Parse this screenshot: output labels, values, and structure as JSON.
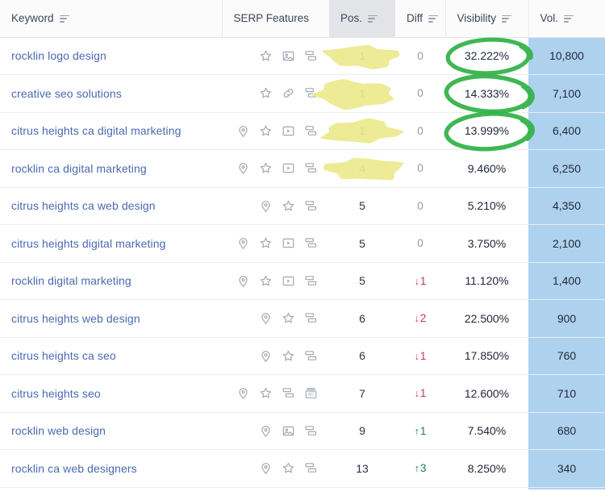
{
  "table": {
    "columns": [
      {
        "key": "keyword",
        "label": "Keyword",
        "sortable": true,
        "sorted": false
      },
      {
        "key": "serp",
        "label": "SERP Features",
        "sortable": false,
        "sorted": false
      },
      {
        "key": "pos",
        "label": "Pos.",
        "sortable": true,
        "sorted": true
      },
      {
        "key": "diff",
        "label": "Diff",
        "sortable": true,
        "sorted": false
      },
      {
        "key": "visibility",
        "label": "Visibility",
        "sortable": true,
        "sorted": false
      },
      {
        "key": "volume",
        "label": "Vol.",
        "sortable": true,
        "sorted": false
      }
    ],
    "rows": [
      {
        "keyword": "rocklin logo design",
        "serp_features": [
          "image-pack-icon",
          "sitelinks-icon"
        ],
        "serp_features_full": [
          "review-star-icon",
          "image-pack-icon",
          "sitelinks-icon"
        ],
        "pos": "1",
        "diff": "0",
        "diff_dir": "none",
        "visibility": "32.222%",
        "volume": "10,800",
        "pos_highlight": true,
        "visibility_circled": true
      },
      {
        "keyword": "creative seo solutions",
        "serp_features_full": [
          "review-star-icon",
          "link-icon",
          "sitelinks-icon"
        ],
        "pos": "1",
        "diff": "0",
        "diff_dir": "none",
        "visibility": "14.333%",
        "volume": "7,100",
        "pos_highlight": true,
        "visibility_circled": true
      },
      {
        "keyword": "citrus heights ca digital marketing",
        "serp_features_full": [
          "local-pack-icon",
          "review-star-icon",
          "video-icon",
          "sitelinks-icon"
        ],
        "pos": "1",
        "diff": "0",
        "diff_dir": "none",
        "visibility": "13.999%",
        "volume": "6,400",
        "pos_highlight": true,
        "visibility_circled": true
      },
      {
        "keyword": "rocklin ca digital marketing",
        "serp_features_full": [
          "local-pack-icon",
          "review-star-icon",
          "video-icon",
          "sitelinks-icon"
        ],
        "pos": "4",
        "diff": "0",
        "diff_dir": "none",
        "visibility": "9.460%",
        "volume": "6,250",
        "pos_highlight": true,
        "visibility_circled": false
      },
      {
        "keyword": "citrus heights ca web design",
        "serp_features_full": [
          "local-pack-icon",
          "review-star-icon",
          "sitelinks-icon"
        ],
        "pos": "5",
        "diff": "0",
        "diff_dir": "none",
        "visibility": "5.210%",
        "volume": "4,350",
        "pos_highlight": false,
        "visibility_circled": false
      },
      {
        "keyword": "citrus heights digital marketing",
        "serp_features_full": [
          "local-pack-icon",
          "review-star-icon",
          "video-icon",
          "sitelinks-icon"
        ],
        "pos": "5",
        "diff": "0",
        "diff_dir": "none",
        "visibility": "3.750%",
        "volume": "2,100",
        "pos_highlight": false,
        "visibility_circled": false
      },
      {
        "keyword": "rocklin digital marketing",
        "serp_features_full": [
          "local-pack-icon",
          "review-star-icon",
          "video-icon",
          "sitelinks-icon"
        ],
        "pos": "5",
        "diff": "1",
        "diff_dir": "down",
        "visibility": "11.120%",
        "volume": "1,400",
        "pos_highlight": false,
        "visibility_circled": false
      },
      {
        "keyword": "citrus heights web design",
        "serp_features_full": [
          "local-pack-icon",
          "review-star-icon",
          "sitelinks-icon"
        ],
        "pos": "6",
        "diff": "2",
        "diff_dir": "down",
        "visibility": "22.500%",
        "volume": "900",
        "pos_highlight": false,
        "visibility_circled": false
      },
      {
        "keyword": "citrus heights ca seo",
        "serp_features_full": [
          "local-pack-icon",
          "review-star-icon",
          "sitelinks-icon"
        ],
        "pos": "6",
        "diff": "1",
        "diff_dir": "down",
        "visibility": "17.850%",
        "volume": "760",
        "pos_highlight": false,
        "visibility_circled": false
      },
      {
        "keyword": "citrus heights seo",
        "serp_features_full": [
          "local-pack-icon",
          "review-star-icon",
          "sitelinks-icon",
          "ads-icon"
        ],
        "pos": "7",
        "diff": "1",
        "diff_dir": "down",
        "visibility": "12.600%",
        "volume": "710",
        "pos_highlight": false,
        "visibility_circled": false
      },
      {
        "keyword": "rocklin web design",
        "serp_features_full": [
          "local-pack-icon",
          "image-pack-icon",
          "sitelinks-icon"
        ],
        "pos": "9",
        "diff": "1",
        "diff_dir": "up",
        "visibility": "7.540%",
        "volume": "680",
        "pos_highlight": false,
        "visibility_circled": false
      },
      {
        "keyword": "rocklin ca web designers",
        "serp_features_full": [
          "local-pack-icon",
          "review-star-icon",
          "sitelinks-icon"
        ],
        "pos": "13",
        "diff": "3",
        "diff_dir": "up",
        "visibility": "8.250%",
        "volume": "340",
        "pos_highlight": false,
        "visibility_circled": false
      }
    ]
  },
  "annotations": {
    "highlighter_color": "#ece98d",
    "circle_color": "#35b34a",
    "highlighted_positions": [
      "1",
      "1",
      "1",
      "4"
    ],
    "circled_visibility": [
      "32.222%",
      "14.333%",
      "13.999%"
    ]
  },
  "colors": {
    "link": "#4a6ab0",
    "volume_column_bg": "#aed2ee",
    "sorted_header_bg": "#e2e4e8",
    "diff_down": "#c9345c",
    "diff_up": "#1f7a5c"
  }
}
